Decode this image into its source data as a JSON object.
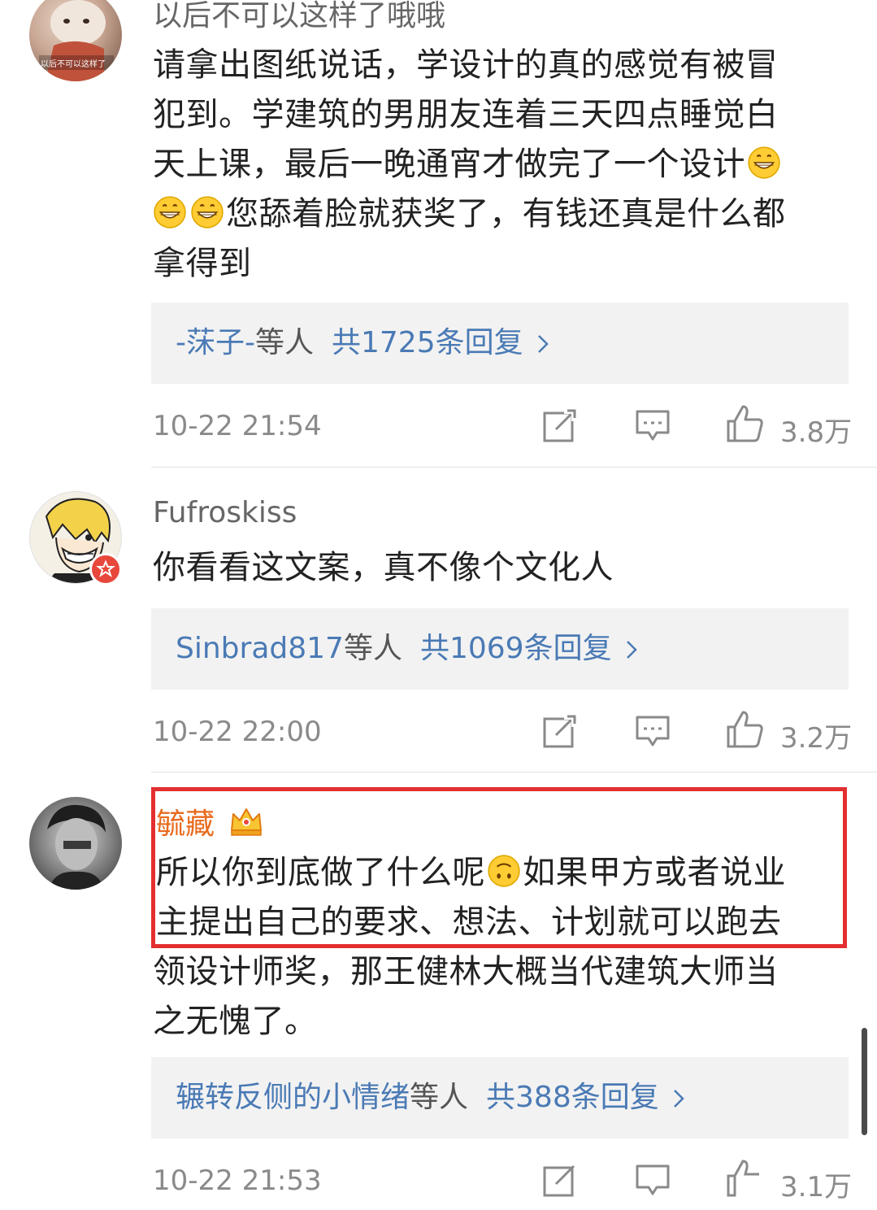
{
  "comments": [
    {
      "username": "以后不可以这样了哦哦",
      "avatar_caption": "以后不可以这样了",
      "lines": [
        "请拿出图纸说话，学设计的真的感觉有被冒",
        "犯到。学建筑的男朋友连着三天四点睡觉白",
        "天上课，最后一晚通宵才做完了一个设计",
        "您舔着脸就获奖了，有钱还真是什么都",
        "拿得到"
      ],
      "reply_names": "-莯子-",
      "reply_etc": "等人",
      "reply_count": "共1725条回复",
      "time": "10-22 21:54",
      "likes": "3.8万"
    },
    {
      "username": "Fufroskiss",
      "lines": [
        "你看看这文案，真不像个文化人"
      ],
      "reply_names": "Sinbrad817",
      "reply_etc": "等人",
      "reply_count": "共1069条回复",
      "time": "10-22 22:00",
      "likes": "3.2万"
    },
    {
      "username": "毓藏",
      "lines": [
        "所以你到底做了什么呢",
        "如果甲方或者说业",
        "主提出自己的要求、想法、计划就可以跑去",
        "领设计师奖，那王健林大概当代建筑大师当",
        "之无愧了。"
      ],
      "reply_names": "辗转反侧的小情绪",
      "reply_etc": "等人",
      "reply_count": "共388条回复",
      "time": "10-22 21:53",
      "likes": "3.1万"
    }
  ],
  "icons": {
    "share": "share-icon",
    "comment": "comment-icon",
    "like": "thumbs-up-icon",
    "chevron": "chevron-right-icon",
    "emoji_grin": "grin-emoji-icon",
    "emoji_upside": "upside-down-face-emoji-icon",
    "crown": "crown-vip-icon"
  },
  "colors": {
    "link_blue": "#4a7ab5",
    "highlight_red": "#e32f2f",
    "vip_orange": "#e86a1c",
    "meta_gray": "#8a8a8a"
  }
}
